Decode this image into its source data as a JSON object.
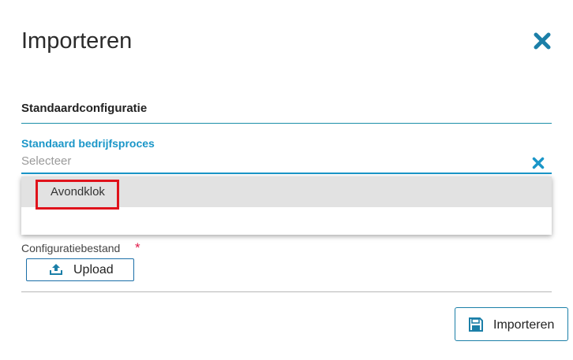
{
  "dialog": {
    "title": "Importeren"
  },
  "section": {
    "title": "Standaardconfiguratie"
  },
  "field": {
    "label": "Standaard bedrijfsproces",
    "placeholder": "Selecteer"
  },
  "dropdown": {
    "options": [
      {
        "label": "Avondklok"
      }
    ]
  },
  "upload": {
    "label": "Configuratiebestand",
    "required_mark": "*",
    "button_label": "Upload"
  },
  "footer": {
    "import_label": "Importeren"
  },
  "colors": {
    "accent": "#1a96c8",
    "icon": "#1b7fa8",
    "required": "#e01b4a",
    "highlight": "#e0121b"
  }
}
